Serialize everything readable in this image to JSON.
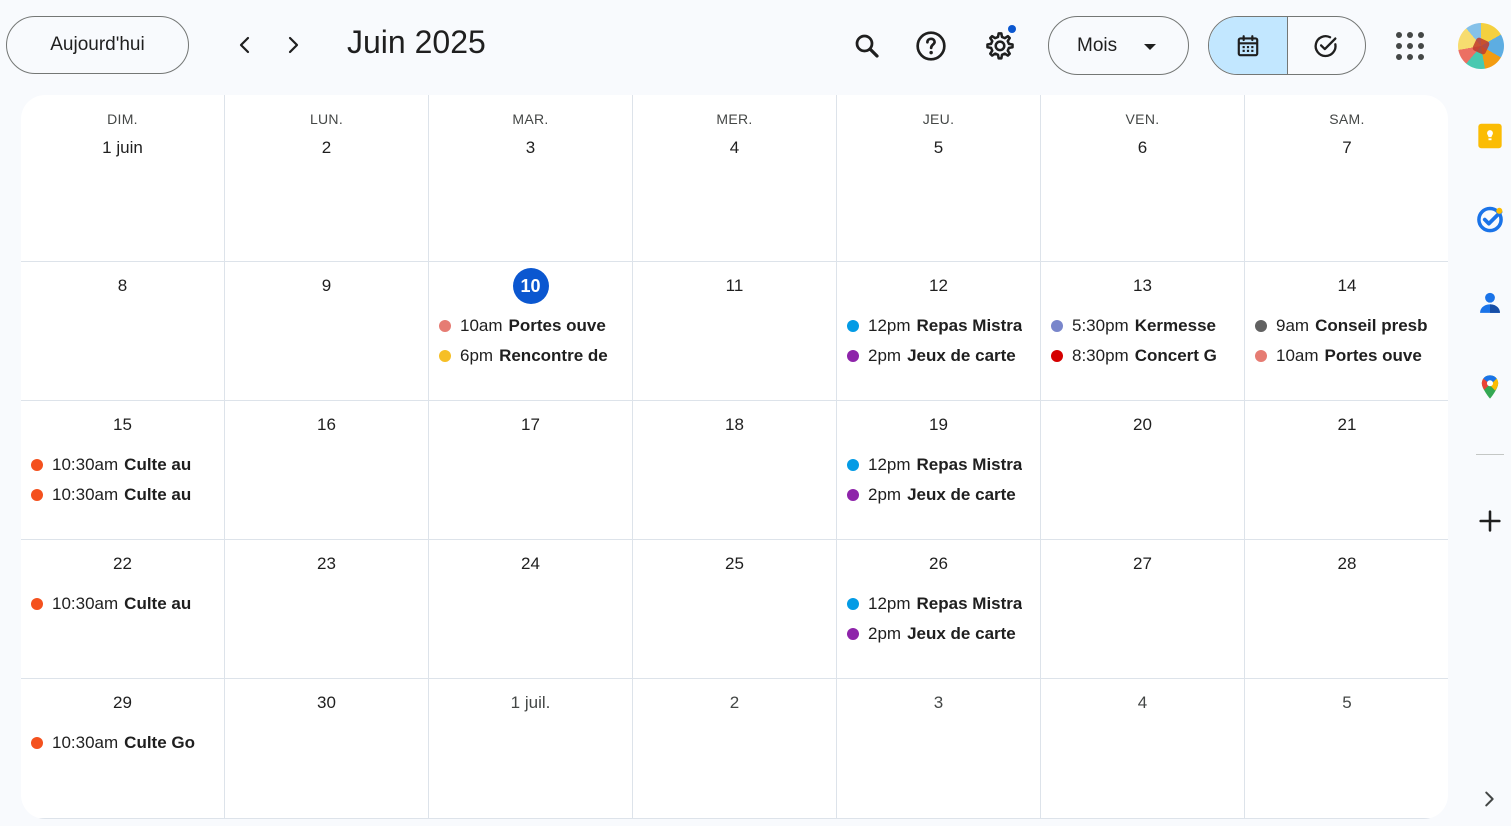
{
  "toolbar": {
    "today_label": "Aujourd'hui",
    "title": "Juin 2025",
    "view_label": "Mois",
    "icons": [
      "chevron-left-icon",
      "chevron-right-icon",
      "search-icon",
      "help-icon",
      "settings-icon",
      "calendar-icon",
      "tasks-icon",
      "apps-icon"
    ]
  },
  "weekdays": [
    "DIM.",
    "LUN.",
    "MAR.",
    "MER.",
    "JEU.",
    "VEN.",
    "SAM."
  ],
  "weeks": [
    [
      {
        "label": "1 juin",
        "muted": false,
        "events": []
      },
      {
        "label": "2",
        "muted": false,
        "events": []
      },
      {
        "label": "3",
        "muted": false,
        "events": []
      },
      {
        "label": "4",
        "muted": false,
        "events": []
      },
      {
        "label": "5",
        "muted": false,
        "events": []
      },
      {
        "label": "6",
        "muted": false,
        "events": []
      },
      {
        "label": "7",
        "muted": false,
        "events": []
      }
    ],
    [
      {
        "label": "8",
        "events": []
      },
      {
        "label": "9",
        "events": []
      },
      {
        "label": "10",
        "today": true,
        "events": [
          {
            "time": "10am",
            "title": "Portes ouve",
            "color": "#e67c73"
          },
          {
            "time": "6pm",
            "title": "Rencontre de",
            "color": "#f6bf26"
          }
        ]
      },
      {
        "label": "11",
        "events": []
      },
      {
        "label": "12",
        "events": [
          {
            "time": "12pm",
            "title": "Repas Mistra",
            "color": "#039be5"
          },
          {
            "time": "2pm",
            "title": "Jeux de carte",
            "color": "#8e24aa"
          }
        ]
      },
      {
        "label": "13",
        "events": [
          {
            "time": "5:30pm",
            "title": "Kermesse",
            "color": "#7986cb"
          },
          {
            "time": "8:30pm",
            "title": "Concert G",
            "color": "#d50000"
          }
        ]
      },
      {
        "label": "14",
        "events": [
          {
            "time": "9am",
            "title": "Conseil presb",
            "color": "#616161"
          },
          {
            "time": "10am",
            "title": "Portes ouve",
            "color": "#e67c73"
          }
        ]
      }
    ],
    [
      {
        "label": "15",
        "events": [
          {
            "time": "10:30am",
            "title": "Culte au",
            "color": "#f4511e"
          },
          {
            "time": "10:30am",
            "title": "Culte au",
            "color": "#f4511e"
          }
        ]
      },
      {
        "label": "16",
        "events": []
      },
      {
        "label": "17",
        "events": []
      },
      {
        "label": "18",
        "events": []
      },
      {
        "label": "19",
        "events": [
          {
            "time": "12pm",
            "title": "Repas Mistra",
            "color": "#039be5"
          },
          {
            "time": "2pm",
            "title": "Jeux de carte",
            "color": "#8e24aa"
          }
        ]
      },
      {
        "label": "20",
        "events": []
      },
      {
        "label": "21",
        "events": []
      }
    ],
    [
      {
        "label": "22",
        "events": [
          {
            "time": "10:30am",
            "title": "Culte au",
            "color": "#f4511e"
          }
        ]
      },
      {
        "label": "23",
        "events": []
      },
      {
        "label": "24",
        "events": []
      },
      {
        "label": "25",
        "events": []
      },
      {
        "label": "26",
        "events": [
          {
            "time": "12pm",
            "title": "Repas Mistra",
            "color": "#039be5"
          },
          {
            "time": "2pm",
            "title": "Jeux de carte",
            "color": "#8e24aa"
          }
        ]
      },
      {
        "label": "27",
        "events": []
      },
      {
        "label": "28",
        "events": []
      }
    ],
    [
      {
        "label": "29",
        "events": [
          {
            "time": "10:30am",
            "title": "Culte Go",
            "color": "#f4511e"
          }
        ]
      },
      {
        "label": "30",
        "events": []
      },
      {
        "label": "1 juil.",
        "muted": true,
        "events": []
      },
      {
        "label": "2",
        "muted": true,
        "events": []
      },
      {
        "label": "3",
        "muted": true,
        "events": []
      },
      {
        "label": "4",
        "muted": true,
        "events": []
      },
      {
        "label": "5",
        "muted": true,
        "events": []
      }
    ]
  ],
  "side_panel": {
    "icons": [
      "keep-icon",
      "tasks-icon",
      "contacts-icon",
      "maps-icon",
      "add-icon",
      "expand-icon"
    ]
  },
  "colors": {
    "accent": "#0b57d0",
    "active_view_bg": "#c2e7ff"
  }
}
